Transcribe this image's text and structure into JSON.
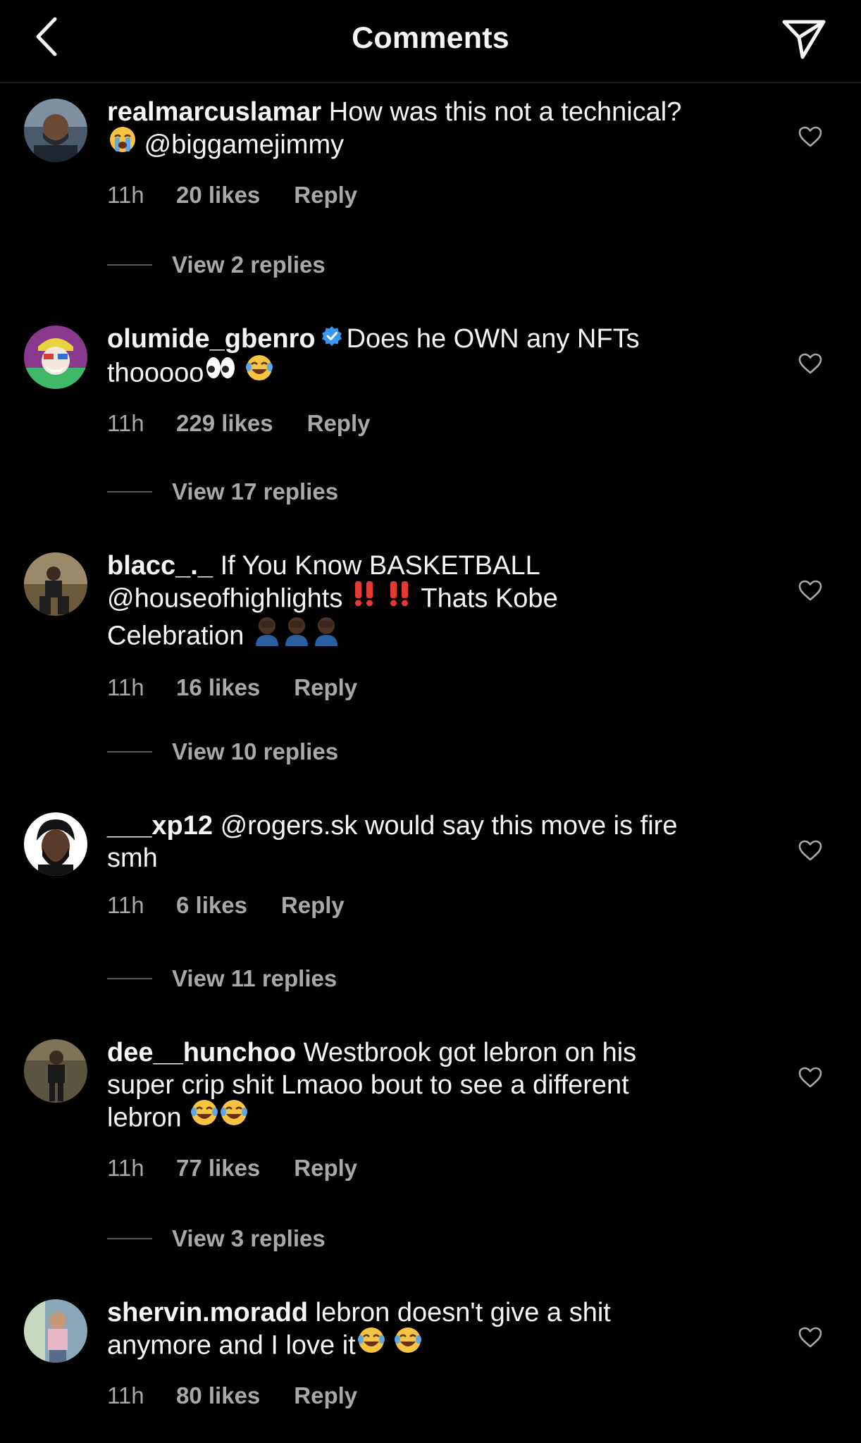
{
  "header": {
    "title": "Comments"
  },
  "comments": [
    {
      "username": "realmarcuslamar",
      "verified": false,
      "text_line1": "How was this not a technical?",
      "text_line2": "@biggamejimmy",
      "emoji_before_line2": "loudly-crying-face",
      "time": "11h",
      "likes": "20 likes",
      "reply": "Reply",
      "view_replies": "View 2 replies"
    },
    {
      "username": "olumide_gbenro",
      "verified": true,
      "text_line1": "Does he OWN any NFTs",
      "text_line2": "thooooo",
      "emojis": [
        "eyes",
        "face-with-tears-of-joy"
      ],
      "time": "11h",
      "likes": "229 likes",
      "reply": "Reply",
      "view_replies": "View 17 replies"
    },
    {
      "username": "blacc_._",
      "verified": false,
      "text_line1": "If You Know BASKETBALL",
      "text_line2a": "@houseofhighlights",
      "text_line2b": "Thats Kobe",
      "text_line3": "Celebration",
      "emojis": [
        "double-exclamation-mark",
        "double-exclamation-mark",
        "person-facepalming",
        "person-facepalming",
        "person-facepalming"
      ],
      "time": "11h",
      "likes": "16 likes",
      "reply": "Reply",
      "view_replies": "View 10 replies"
    },
    {
      "username": "___xp12",
      "verified": false,
      "text_line1": "@rogers.sk would say this move is fire",
      "text_line2": "smh",
      "time": "11h",
      "likes": "6 likes",
      "reply": "Reply",
      "view_replies": "View 11 replies"
    },
    {
      "username": "dee__hunchoo",
      "verified": false,
      "text_line1": "Westbrook got lebron on his",
      "text_line2": "super crip shit Lmaoo bout to see  a different",
      "text_line3": "lebron",
      "emojis": [
        "face-with-tears-of-joy",
        "face-with-tears-of-joy"
      ],
      "time": "11h",
      "likes": "77 likes",
      "reply": "Reply",
      "view_replies": "View 3 replies"
    },
    {
      "username": "shervin.moradd",
      "verified": false,
      "text_line1": "lebron doesn't give a shit",
      "text_line2": "anymore and I love it",
      "emojis": [
        "face-with-tears-of-joy",
        "face-with-tears-of-joy"
      ],
      "time": "11h",
      "likes": "80 likes",
      "reply": "Reply"
    }
  ],
  "colors": {
    "background": "#000000",
    "text_primary": "#f5f5f5",
    "text_secondary": "#a8a8a8",
    "verified_blue": "#3897f0",
    "divider": "#262626"
  },
  "icons": {
    "back": "chevron-left-icon",
    "share": "paper-plane-icon",
    "like": "heart-outline-icon"
  }
}
